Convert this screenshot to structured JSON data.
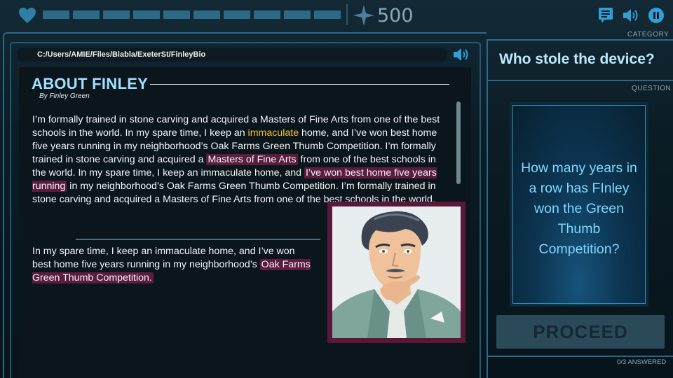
{
  "hud": {
    "score": "500",
    "progress_segments": 10
  },
  "document": {
    "path": "C:/Users/AMIE/Files/Blabla/ExeterSt/FinleyBio",
    "title": "ABOUT FINLEY",
    "byline": "By Finley Green",
    "p1": [
      "I’m formally trained in stone carving and acquired a Masters of Fine Arts from one of the best schools in the world. In my spare time, I keep an ",
      "immaculate",
      " home, and I’ve won best home five years running in my neighborhood’s Oak Farms Green Thumb Competition. I’m formally trained in stone carving and acquired a ",
      "Masters of Fine Arts",
      " from one of the best schools in the world. In my spare time, I keep an immaculate home, and ",
      "I’ve won best home five years running",
      " in my neighborhood’s Oak Farms Green Thumb Competition. I’m formally trained in stone carving and acquired a Masters of Fine Arts from one of the best schools in the world."
    ],
    "p2": [
      "In my spare time, I keep an immaculate home, and I’ve won best home five years running in my neighborhood’s ",
      "Oak Farms Green Thumb Competition."
    ]
  },
  "sidebar": {
    "category_label": "CATEGORY",
    "category_title": "Who stole the device?",
    "question_label": "QUESTION",
    "question_text": "How many years in a row has FInley won the Green Thumb Competition?",
    "proceed_label": "PROCEED",
    "answered": "0/3 ANSWERED"
  },
  "colors": {
    "accent": "#9fe0ff",
    "highlight": "#5b1c3e",
    "gold": "#f2c230",
    "frame": "#2b6a86"
  }
}
